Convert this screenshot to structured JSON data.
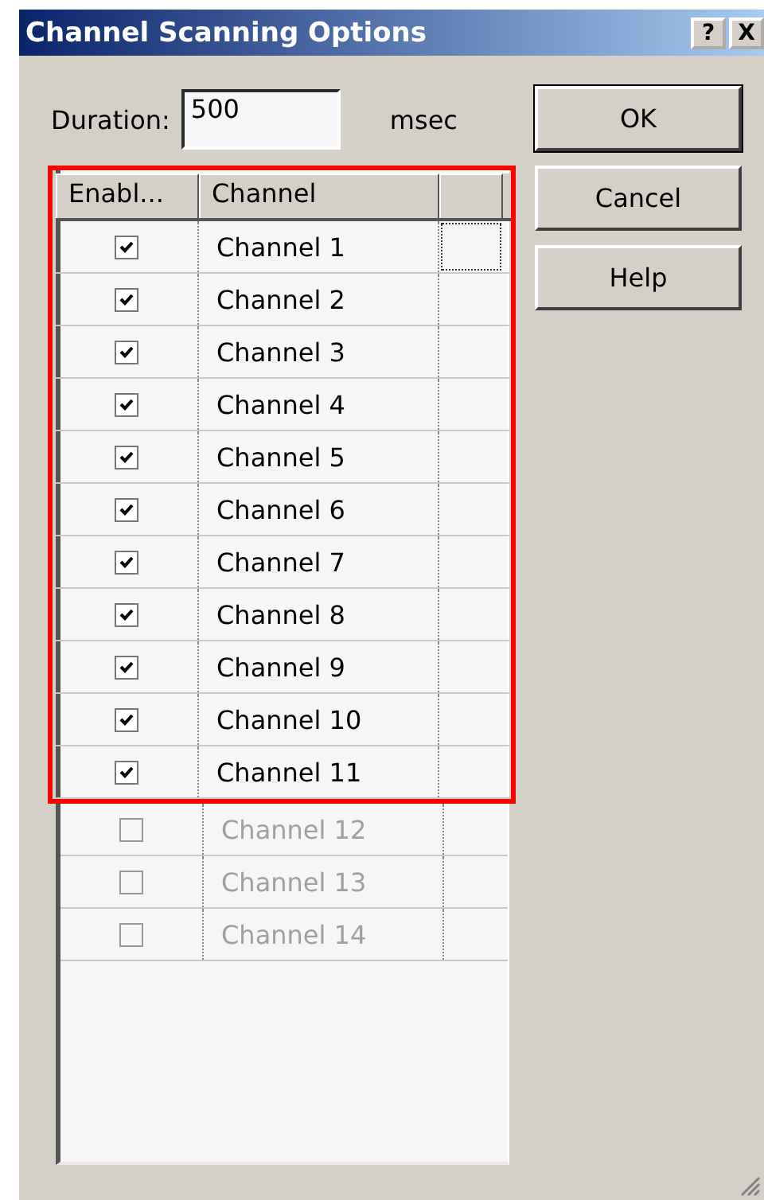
{
  "window": {
    "title": "Channel Scanning Options",
    "title_buttons": [
      "?",
      "X"
    ]
  },
  "duration": {
    "label": "Duration:",
    "value": "500",
    "unit": "msec"
  },
  "buttons": [
    {
      "label": "OK",
      "default": true
    },
    {
      "label": "Cancel",
      "default": false
    },
    {
      "label": "Help",
      "default": false
    }
  ],
  "table": {
    "columns": [
      "Enabl...",
      "Channel"
    ],
    "rows": [
      {
        "channel": "Channel 1",
        "checked": true,
        "disabled": false,
        "highlighted": true,
        "focused": true
      },
      {
        "channel": "Channel 2",
        "checked": true,
        "disabled": false,
        "highlighted": true,
        "focused": false
      },
      {
        "channel": "Channel 3",
        "checked": true,
        "disabled": false,
        "highlighted": true,
        "focused": false
      },
      {
        "channel": "Channel 4",
        "checked": true,
        "disabled": false,
        "highlighted": true,
        "focused": false
      },
      {
        "channel": "Channel 5",
        "checked": true,
        "disabled": false,
        "highlighted": true,
        "focused": false
      },
      {
        "channel": "Channel 6",
        "checked": true,
        "disabled": false,
        "highlighted": true,
        "focused": false
      },
      {
        "channel": "Channel 7",
        "checked": true,
        "disabled": false,
        "highlighted": true,
        "focused": false
      },
      {
        "channel": "Channel 8",
        "checked": true,
        "disabled": false,
        "highlighted": true,
        "focused": false
      },
      {
        "channel": "Channel 9",
        "checked": true,
        "disabled": false,
        "highlighted": true,
        "focused": false
      },
      {
        "channel": "Channel 10",
        "checked": true,
        "disabled": false,
        "highlighted": true,
        "focused": false
      },
      {
        "channel": "Channel 11",
        "checked": true,
        "disabled": false,
        "highlighted": true,
        "focused": false
      },
      {
        "channel": "Channel 12",
        "checked": false,
        "disabled": true,
        "highlighted": false,
        "focused": false
      },
      {
        "channel": "Channel 13",
        "checked": false,
        "disabled": true,
        "highlighted": false,
        "focused": false
      },
      {
        "channel": "Channel 14",
        "checked": false,
        "disabled": true,
        "highlighted": false,
        "focused": false
      }
    ]
  }
}
